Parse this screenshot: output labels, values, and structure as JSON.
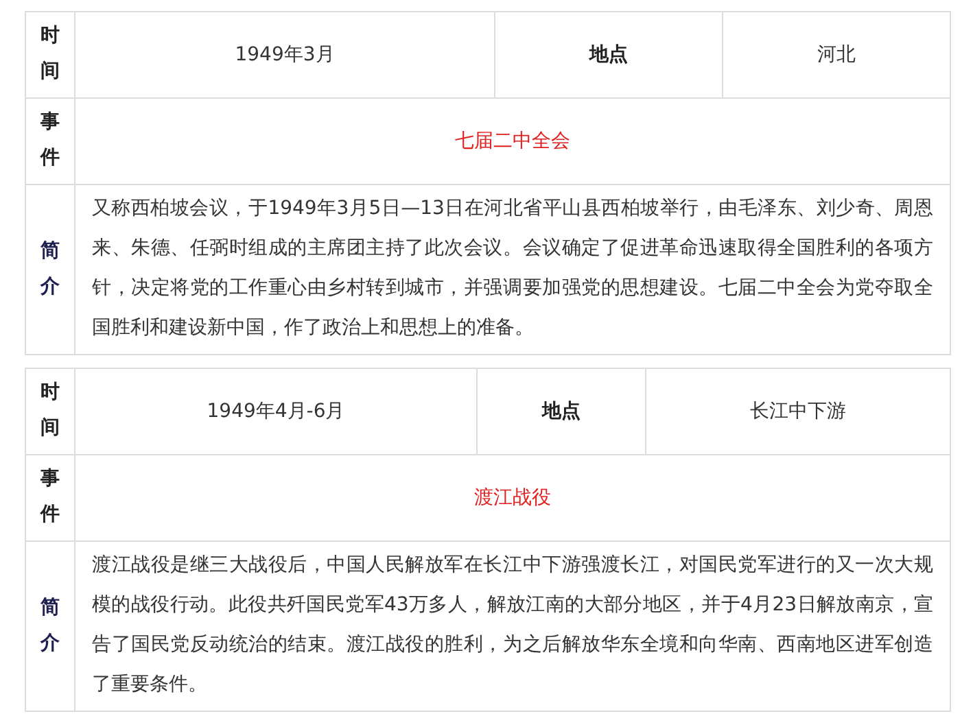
{
  "entries": [
    {
      "time_label": "时间",
      "time": "1949年3月",
      "place_label": "地点",
      "place": "河北",
      "event_label": "事件",
      "event": "七届二中全会",
      "summary_label": "简介",
      "summary": "又称西柏坡会议，于1949年3月5日—13日在河北省平山县西柏坡举行，由毛泽东、刘少奇、周恩来、朱德、任弼时组成的主席团主持了此次会议。会议确定了促进革命迅速取得全国胜利的各项方针，决定将党的工作重心由乡村转到城市，并强调要加强党的思想建设。七届二中全会为党夺取全国胜利和建设新中国，作了政治上和思想上的准备。"
    },
    {
      "time_label": "时间",
      "time": "1949年4月-6月",
      "place_label": "地点",
      "place": "长江中下游",
      "event_label": "事件",
      "event": "渡江战役",
      "summary_label": "简介",
      "summary": "渡江战役是继三大战役后，中国人民解放军在长江中下游强渡长江，对国民党军进行的又一次大规模的战役行动。此役共歼国民党军43万多人，解放江南的大部分地区，并于4月23日解放南京，宣告了国民党反动统治的结束。渡江战役的胜利，为之后解放华东全境和向华南、西南地区进军创造了重要条件。"
    }
  ]
}
